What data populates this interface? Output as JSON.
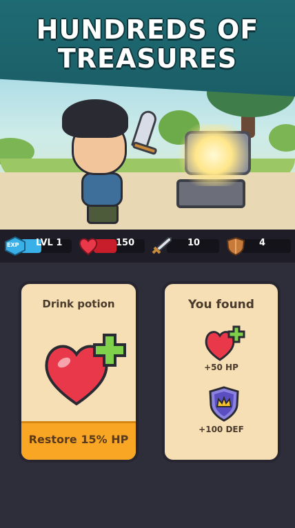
{
  "banner": {
    "title_line1": "HUNDREDS OF",
    "title_line2": "TREASURES"
  },
  "stats": {
    "exp_badge": "EXP",
    "level_label": "LVL 1",
    "health_value": "150",
    "health_fill_fraction": 0.45,
    "attack_value": "10",
    "defense_value": "4",
    "icons": [
      "exp-badge-icon",
      "heart-icon",
      "sword-icon",
      "shield-icon"
    ],
    "colors": {
      "exp": "#3ab0e8",
      "health": "#c81e2c",
      "gold": "#f8a623"
    }
  },
  "potion_card": {
    "title": "Drink potion",
    "action": "Restore 15% HP",
    "icon": "heart-plus-icon"
  },
  "found_card": {
    "title": "You found",
    "rewards": [
      {
        "label": "+50 HP",
        "icon": "heart-plus-icon"
      },
      {
        "label": "+100 DEF",
        "icon": "crown-shield-icon"
      }
    ]
  }
}
